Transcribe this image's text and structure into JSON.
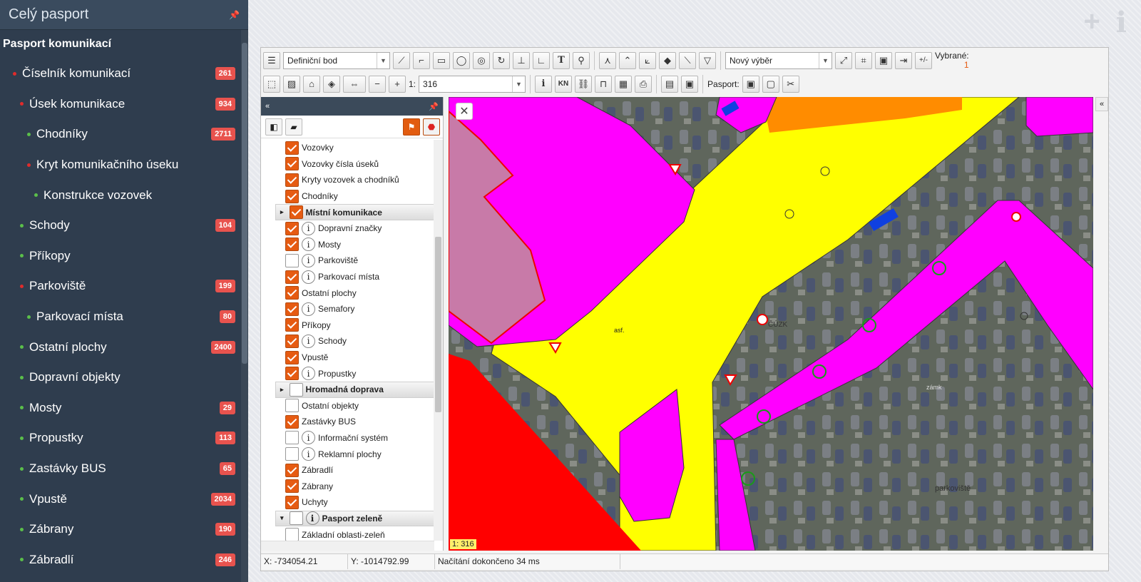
{
  "sidebar": {
    "title": "Celý pasport",
    "root": "Pasport komunikací",
    "items": [
      {
        "label": "Číselník komunikací",
        "count": "261",
        "dot": "#e02b2b",
        "level": 1
      },
      {
        "label": "Úsek komunikace",
        "count": "934",
        "dot": "#e02b2b",
        "level": 2
      },
      {
        "label": "Chodníky",
        "count": "2711",
        "dot": "#5bbf4a",
        "level": 3
      },
      {
        "label": "Kryt komunikačního úseku",
        "count": "",
        "dot": "#e02b2b",
        "level": 3
      },
      {
        "label": "Konstrukce vozovek",
        "count": "",
        "dot": "#5bbf4a",
        "level": 4
      },
      {
        "label": "Schody",
        "count": "104",
        "dot": "#5bbf4a",
        "level": 2
      },
      {
        "label": "Příkopy",
        "count": "",
        "dot": "#5bbf4a",
        "level": 2
      },
      {
        "label": "Parkoviště",
        "count": "199",
        "dot": "#e02b2b",
        "level": 2
      },
      {
        "label": "Parkovací místa",
        "count": "80",
        "dot": "#5bbf4a",
        "level": 3
      },
      {
        "label": "Ostatní plochy",
        "count": "2400",
        "dot": "#5bbf4a",
        "level": 2
      },
      {
        "label": "Dopravní objekty",
        "count": "",
        "dot": "#5bbf4a",
        "level": 2
      },
      {
        "label": "Mosty",
        "count": "29",
        "dot": "#5bbf4a",
        "level": 2
      },
      {
        "label": "Propustky",
        "count": "113",
        "dot": "#5bbf4a",
        "level": 2
      },
      {
        "label": "Zastávky BUS",
        "count": "65",
        "dot": "#5bbf4a",
        "level": 2
      },
      {
        "label": "Vpustě",
        "count": "2034",
        "dot": "#5bbf4a",
        "level": 2
      },
      {
        "label": "Zábrany",
        "count": "190",
        "dot": "#5bbf4a",
        "level": 2
      },
      {
        "label": "Zábradlí",
        "count": "246",
        "dot": "#5bbf4a",
        "level": 2
      }
    ]
  },
  "toolbar": {
    "snap_select": "Definiční bod",
    "selection_select": "Nový výběr",
    "selected_label": "Vybrané:",
    "selected_count": "1",
    "scale_prefix": "1:",
    "scale_value": "316",
    "pasport_label": "Pasport:",
    "plusminus": "+/-",
    "info_btn": "i",
    "kn_btn": "KN",
    "zoom_out": "−",
    "zoom_in": "+"
  },
  "layers": {
    "rows": [
      {
        "label": "Vozovky",
        "checked": true,
        "info": false,
        "group": false
      },
      {
        "label": "Vozovky čísla úseků",
        "checked": true,
        "info": false,
        "group": false
      },
      {
        "label": "Kryty vozovek a chodníků",
        "checked": true,
        "info": false,
        "group": false
      },
      {
        "label": "Chodníky",
        "checked": true,
        "info": false,
        "group": false
      },
      {
        "label": "Místní komunikace",
        "checked": true,
        "info": false,
        "group": true,
        "arrow": "▸"
      },
      {
        "label": "Dopravní značky",
        "checked": true,
        "info": true,
        "group": false
      },
      {
        "label": "Mosty",
        "checked": true,
        "info": true,
        "group": false
      },
      {
        "label": "Parkoviště",
        "checked": false,
        "info": true,
        "group": false
      },
      {
        "label": "Parkovací místa",
        "checked": true,
        "info": true,
        "group": false
      },
      {
        "label": "Ostatní plochy",
        "checked": true,
        "info": false,
        "group": false
      },
      {
        "label": "Semafory",
        "checked": true,
        "info": true,
        "group": false
      },
      {
        "label": "Příkopy",
        "checked": true,
        "info": false,
        "group": false
      },
      {
        "label": "Schody",
        "checked": true,
        "info": true,
        "group": false
      },
      {
        "label": "Vpustě",
        "checked": true,
        "info": false,
        "group": false
      },
      {
        "label": "Propustky",
        "checked": true,
        "info": true,
        "group": false
      },
      {
        "label": "Hromadná doprava",
        "checked": false,
        "info": false,
        "group": true,
        "arrow": "▸"
      },
      {
        "label": "Ostatní objekty",
        "checked": false,
        "info": false,
        "group": false
      },
      {
        "label": "Zastávky BUS",
        "checked": true,
        "info": false,
        "group": false
      },
      {
        "label": "Informační systém",
        "checked": false,
        "info": true,
        "group": false
      },
      {
        "label": "Reklamní plochy",
        "checked": false,
        "info": true,
        "group": false
      },
      {
        "label": "Zábradlí",
        "checked": true,
        "info": false,
        "group": false
      },
      {
        "label": "Zábrany",
        "checked": true,
        "info": false,
        "group": false
      },
      {
        "label": "Uchyty",
        "checked": true,
        "info": false,
        "group": false
      },
      {
        "label": "Pasport zeleně",
        "checked": false,
        "info": true,
        "group": true,
        "arrow": "▾"
      },
      {
        "label": "Základní oblasti-zeleň",
        "checked": false,
        "info": false,
        "group": false
      }
    ]
  },
  "map": {
    "scale_badge": "1: 316",
    "labels": [
      "asf.",
      "ČÚZK",
      "zámk",
      "parkoviště"
    ],
    "colors": {
      "road": "#ffff00",
      "sidewalk": "#ff00ff",
      "other": "#ff0000",
      "orange": "#ff8c00",
      "pink": "#c87aa8"
    }
  },
  "status": {
    "x": "X: -734054.21",
    "y": "Y: -1014792.99",
    "msg": "Načítání dokončeno 34 ms"
  }
}
